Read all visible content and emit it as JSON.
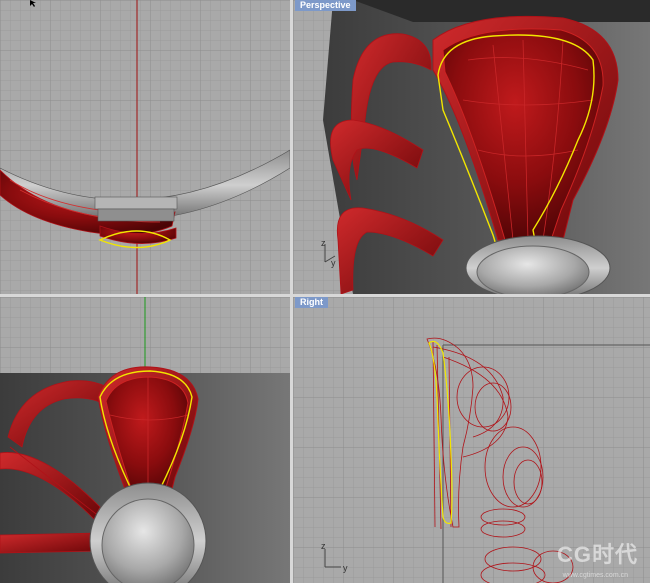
{
  "viewports": {
    "top": {
      "label": ""
    },
    "perspective": {
      "label": "Perspective",
      "axis_z": "z",
      "axis_y": "y"
    },
    "front": {
      "label": ""
    },
    "right": {
      "label": "Right",
      "axis_z": "z",
      "axis_y": "y"
    }
  },
  "watermark": {
    "text": "CG时代",
    "url": "www.cgtimes.com.cn"
  },
  "colors": {
    "grid_bg": "#a9a9a9",
    "grid_line": "#999999",
    "grid_major": "#8c8c8c",
    "surface_red": "#8e0e10",
    "wire_red": "#b01218",
    "curve_yellow": "#f2e600",
    "axis_red": "#a01010",
    "axis_green": "#1a9a1a",
    "label_bg": "#7d99c9"
  },
  "icons": [
    "cursor-icon",
    "axis-icon"
  ]
}
